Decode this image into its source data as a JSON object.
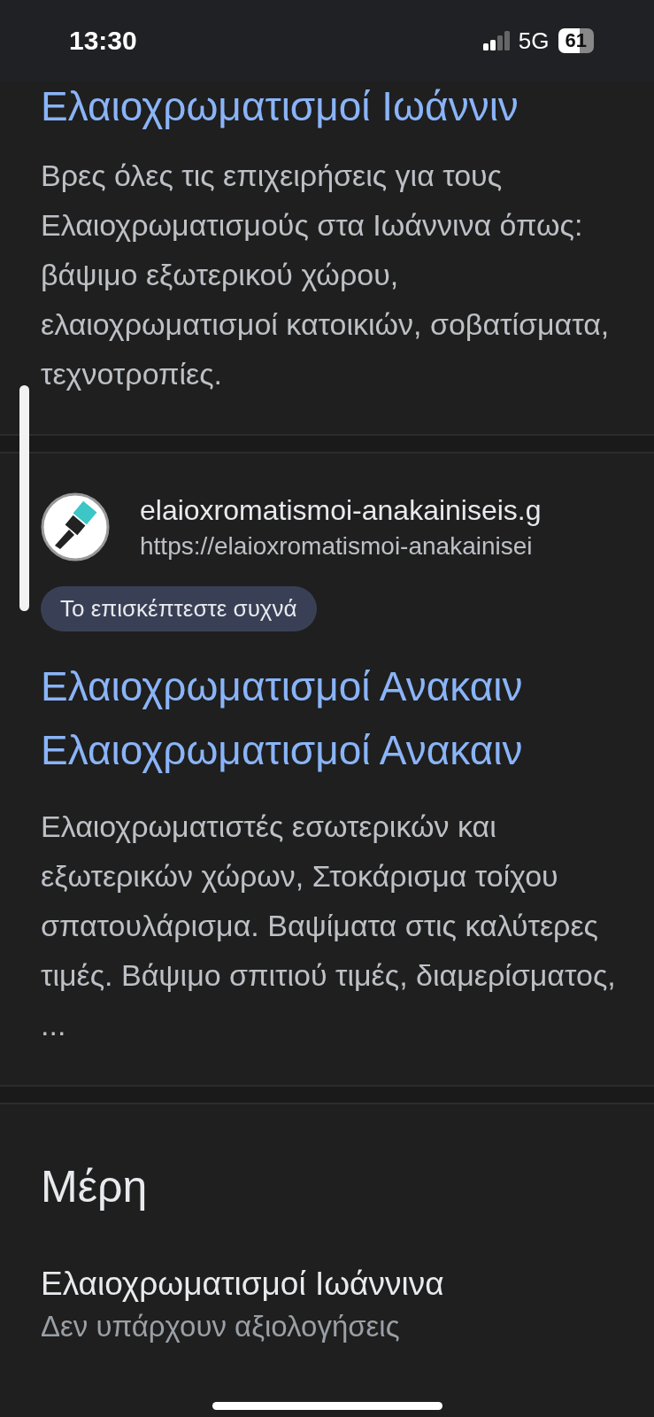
{
  "status_bar": {
    "time": "13:30",
    "network": "5G",
    "battery": "61"
  },
  "results": [
    {
      "kind": "plain",
      "title_lines": [
        "Ελαιοχρωματισμοί Ιωάννιν"
      ],
      "snippet": "Βρες όλες τις επιχειρήσεις για τους Ελαιοχρωματισμούς στα Ιωάννινα όπως: βάψιμο εξωτερικού χώρου, ελαιοχρωματισμοί κατοικιών, σοβατίσματα, τεχνοτροπίες."
    },
    {
      "kind": "site",
      "site_name": "elaioxromatismoi-anakainiseis.g",
      "url": "https://elaioxromatismoi-anakainisei",
      "badge": "Το επισκέπτεστε συχνά",
      "title_lines": [
        "Ελαιοχρωματισμοί Ανακαιν",
        "Ελαιοχρωματισμοί Ανακαιν"
      ],
      "snippet": "Ελαιοχρωματιστές εσωτερικών και εξωτερικών χώρων, Στοκάρισμα τοίχου σπατουλάρισμα. Βαψίματα στις καλύτερες τιμές. Βάψιμο σπιτιού τιμές, διαμερίσματος, ..."
    }
  ],
  "places": {
    "heading": "Μέρη",
    "items": [
      {
        "name": "Ελαιοχρωματισμοί Ιωάννινα",
        "rating": "Δεν υπάρχουν αξιολογήσεις"
      }
    ]
  }
}
